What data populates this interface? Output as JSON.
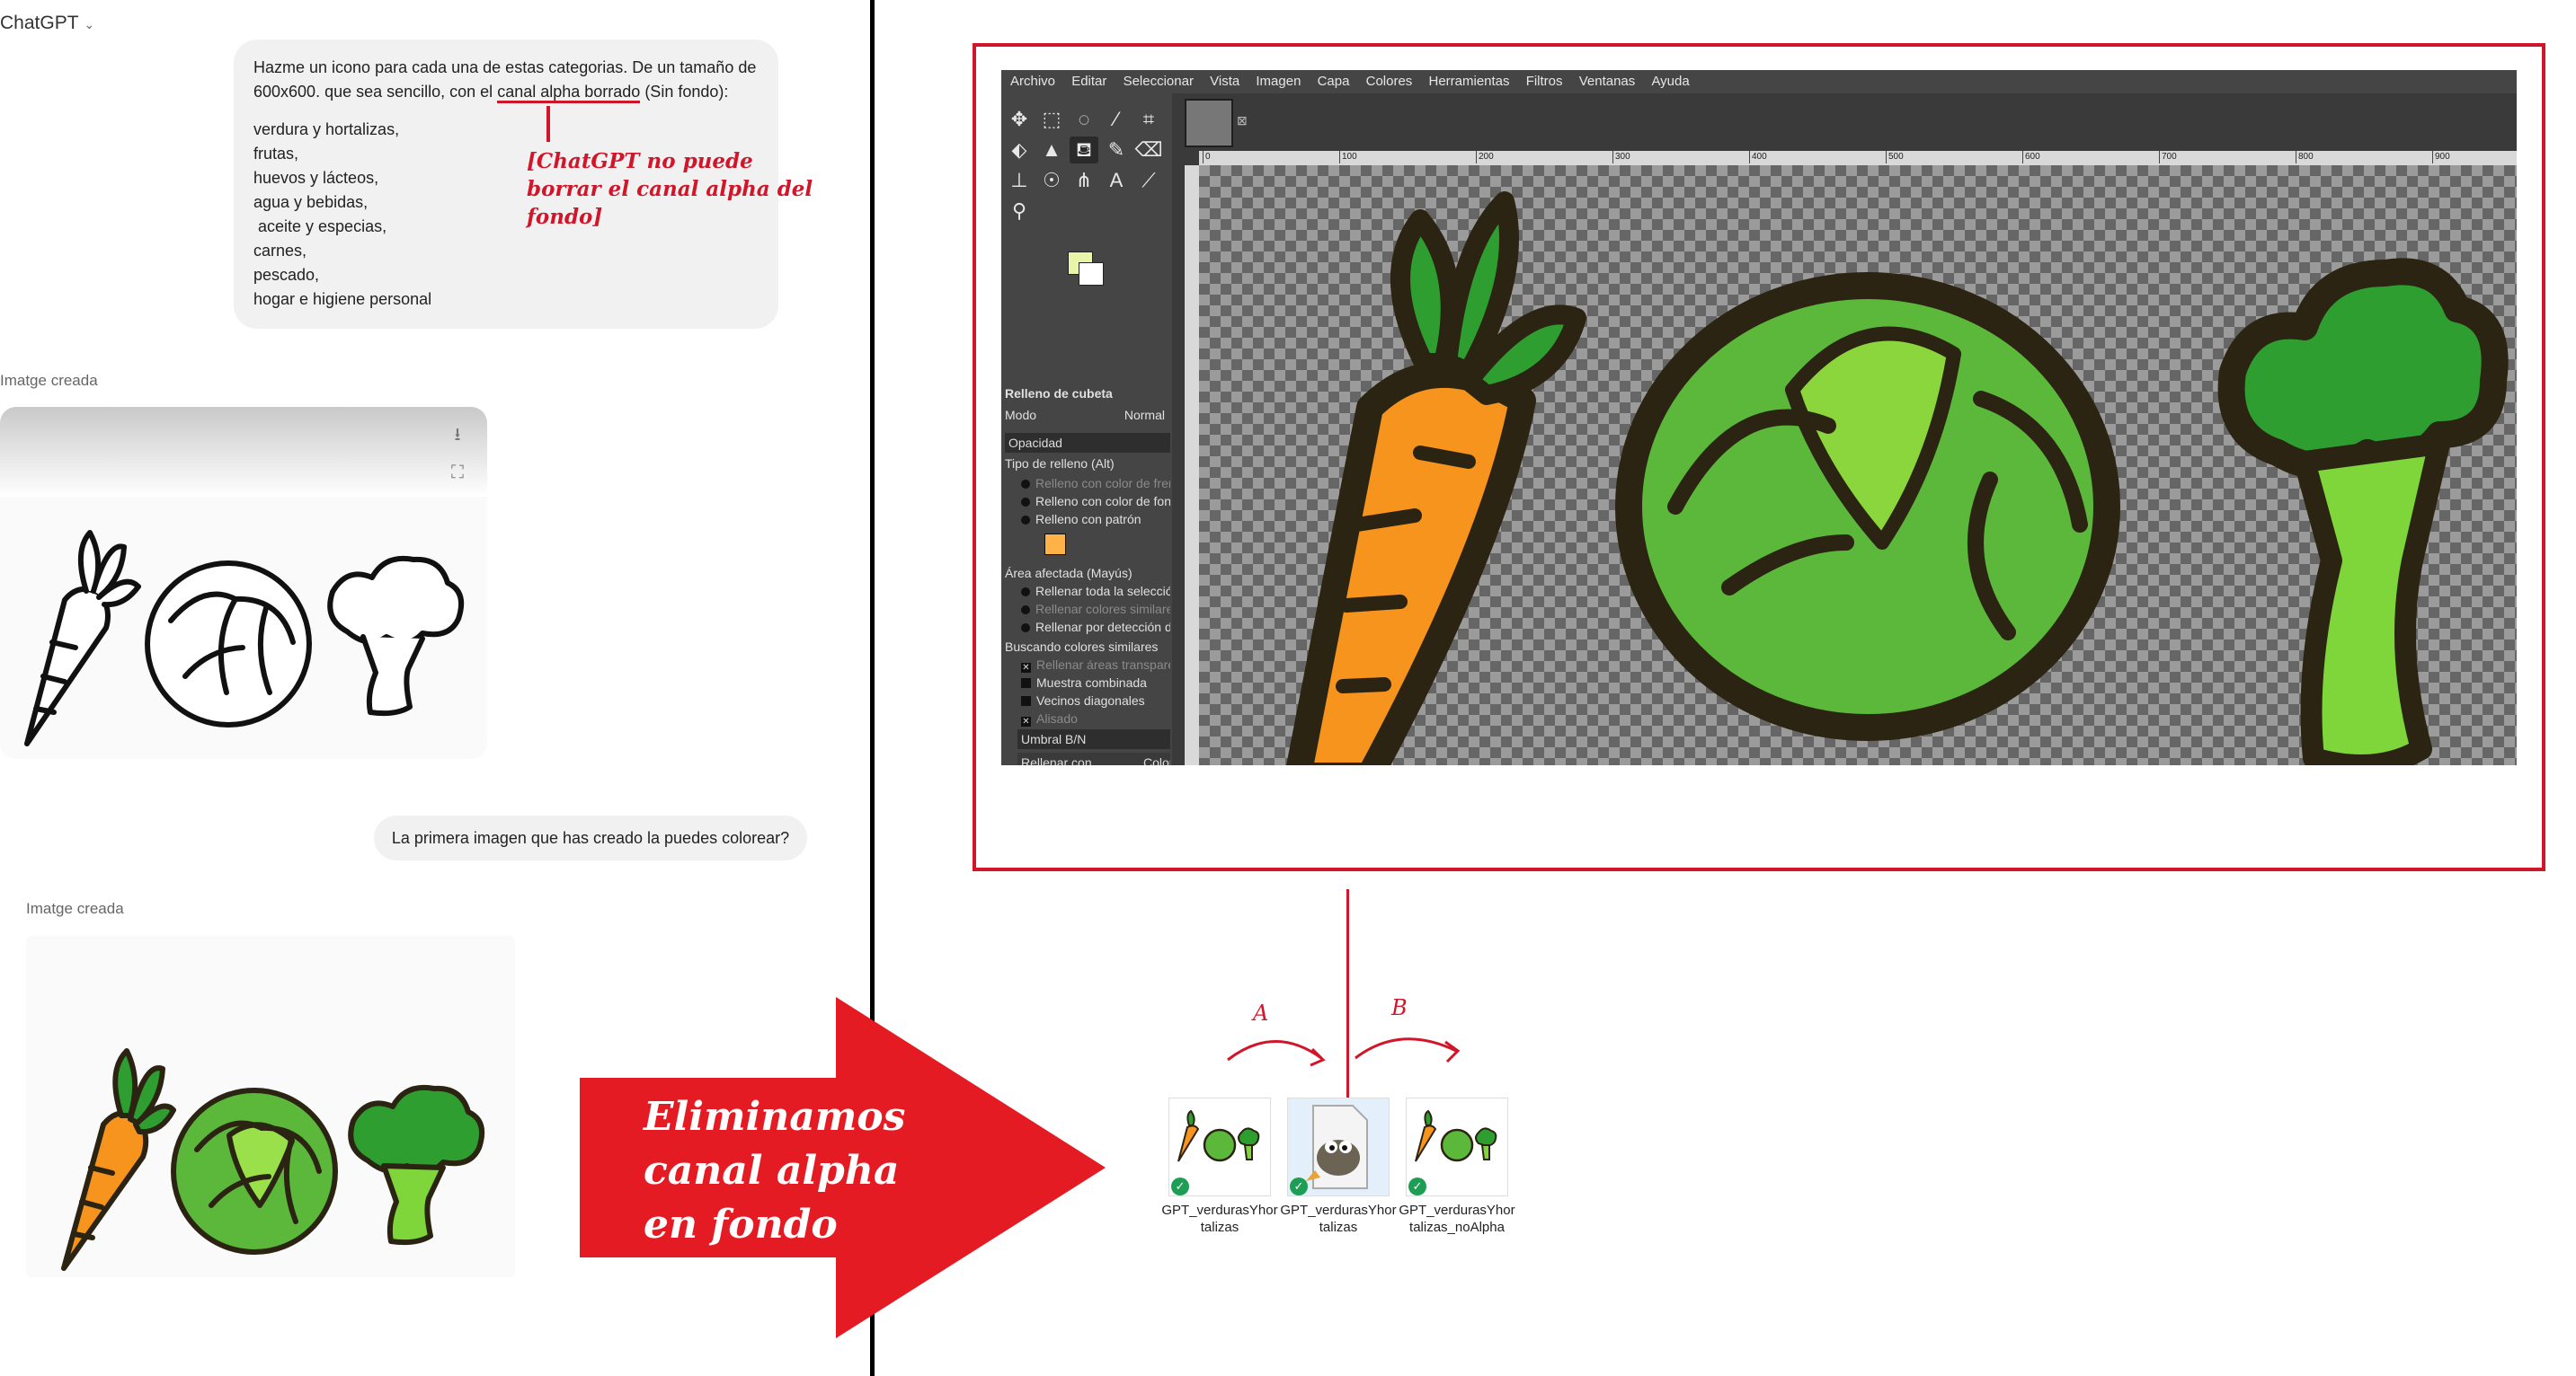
{
  "chat": {
    "app_title": "ChatGPT",
    "prompt_intro": "Hazme un icono para cada una de estas categorias. De un tamaño de 600x600. que sea sencillo, con el ",
    "prompt_highlight": "canal alpha borrado",
    "prompt_tail": " (Sin fondo):",
    "prompt_items": [
      "verdura y hortalizas,",
      "frutas,",
      "huevos y lácteos,",
      "agua y bebidas,",
      " aceite y especias,",
      "carnes,",
      "pescado,",
      "hogar e higiene personal"
    ],
    "annotation": "[ChatGPT no puede borrar el canal alpha del fondo]",
    "image_label_1": "Imatge creada",
    "user_message_2": "La primera imagen que has creado la puedes colorear?",
    "image_label_2": "Imatge creada"
  },
  "arrow_text": [
    "Eliminamos",
    "canal alpha",
    "en fondo"
  ],
  "gimp": {
    "menu": [
      "Archivo",
      "Editar",
      "Seleccionar",
      "Vista",
      "Imagen",
      "Capa",
      "Colores",
      "Herramientas",
      "Filtros",
      "Ventanas",
      "Ayuda"
    ],
    "tool_options_title": "Relleno de cubeta",
    "mode_label": "Modo",
    "mode_value": "Normal",
    "opacity_label": "Opacidad",
    "fill_type_label": "Tipo de relleno  (Alt)",
    "fill_types": [
      "Relleno con color de frente",
      "Relleno con color de fondo",
      "Relleno con patrón"
    ],
    "area_label": "Área afectada  (Mayús)",
    "areas": [
      "Rellenar toda la selección",
      "Rellenar colores similares",
      "Rellenar por detección de línea"
    ],
    "similar_label": "Buscando colores similares",
    "similar_options": [
      "Rellenar áreas transparentes",
      "Muestra combinada",
      "Vecinos diagonales",
      "Alisado"
    ],
    "threshold_label": "Umbral B/N",
    "fill_with_label": "Rellenar con",
    "fill_with_value": "Color",
    "ruler_ticks": [
      "0",
      "100",
      "200",
      "300",
      "400",
      "500",
      "600",
      "700",
      "800",
      "900"
    ]
  },
  "files": {
    "label_a": "A",
    "label_b": "B",
    "items": [
      {
        "name": "GPT_verdurasYhortalizas"
      },
      {
        "name": "GPT_verdurasYhortalizas"
      },
      {
        "name": "GPT_verdurasYhortalizas_noAlpha"
      }
    ]
  },
  "colors": {
    "annotation_red": "#d1162a",
    "carrot": "#f7941d",
    "leaf_green": "#2e9e31",
    "cabbage_light": "#8bd63c",
    "broccoli_stem": "#7fd63a",
    "outline": "#2b2412"
  },
  "icons": [
    "download-icon",
    "expand-icon",
    "move-tool-icon",
    "rect-select-icon",
    "lasso-icon",
    "fuzzy-select-icon",
    "crop-icon",
    "bucket-fill-icon",
    "paintbrush-icon",
    "eraser-icon",
    "text-tool-icon",
    "color-picker-icon",
    "zoom-icon",
    "gimp-wilber-icon",
    "check-badge-icon"
  ]
}
